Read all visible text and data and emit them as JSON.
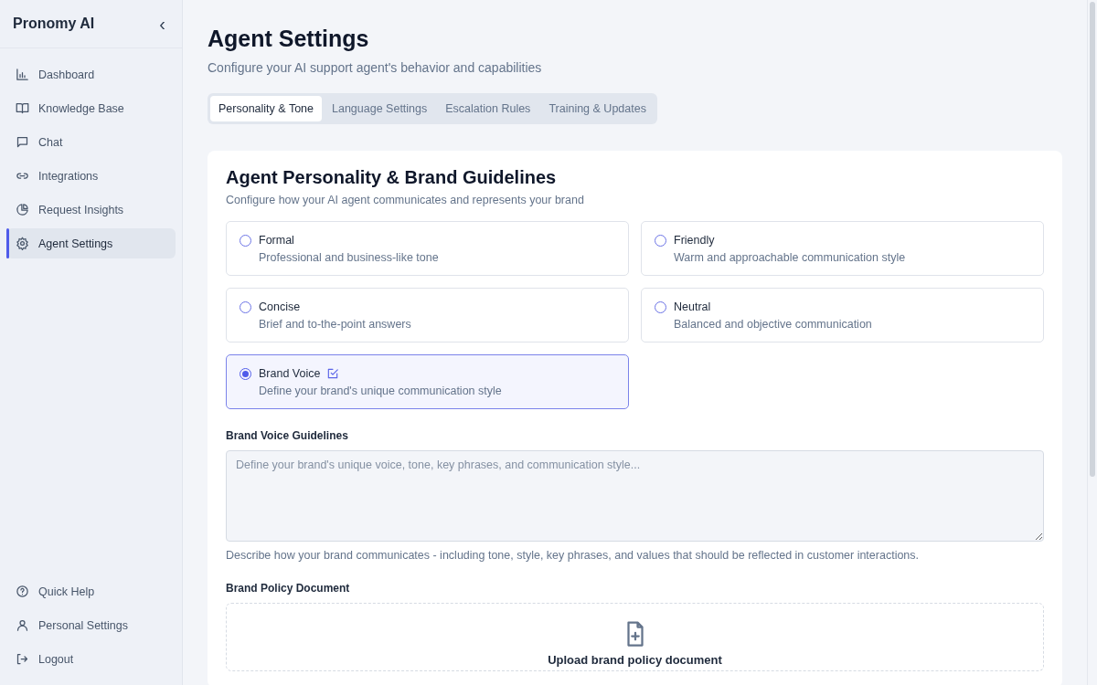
{
  "sidebar": {
    "brand": "Pronomy AI",
    "collapse_icon": "‹",
    "items": [
      {
        "label": "Dashboard",
        "selected": false
      },
      {
        "label": "Knowledge Base",
        "selected": false
      },
      {
        "label": "Chat",
        "selected": false
      },
      {
        "label": "Integrations",
        "selected": false
      },
      {
        "label": "Request Insights",
        "selected": false
      },
      {
        "label": "Agent Settings",
        "selected": true
      }
    ],
    "footer_items": [
      {
        "label": "Quick Help"
      },
      {
        "label": "Personal Settings"
      },
      {
        "label": "Logout"
      }
    ]
  },
  "header": {
    "title": "Agent Settings",
    "subtitle": "Configure your AI support agent's behavior and capabilities"
  },
  "tabs": [
    {
      "label": "Personality & Tone",
      "selected": true
    },
    {
      "label": "Language Settings",
      "selected": false
    },
    {
      "label": "Escalation Rules",
      "selected": false
    },
    {
      "label": "Training & Updates",
      "selected": false
    }
  ],
  "card": {
    "title": "Agent Personality & Brand Guidelines",
    "subtitle": "Configure how your AI agent communicates and represents your brand",
    "tones": [
      {
        "label": "Formal",
        "description": "Professional and business-like tone",
        "selected": false,
        "editable": false
      },
      {
        "label": "Friendly",
        "description": "Warm and approachable communication style",
        "selected": false,
        "editable": false
      },
      {
        "label": "Concise",
        "description": "Brief and to-the-point answers",
        "selected": false,
        "editable": false
      },
      {
        "label": "Neutral",
        "description": "Balanced and objective communication",
        "selected": false,
        "editable": false
      },
      {
        "label": "Brand Voice",
        "description": "Define your brand's unique communication style",
        "selected": true,
        "editable": true
      }
    ],
    "guidelines": {
      "label": "Brand Voice Guidelines",
      "placeholder": "Define your brand's unique voice, tone, key phrases, and communication style...",
      "help": "Describe how your brand communicates - including tone, style, key phrases, and values that should be reflected in customer interactions."
    },
    "policy": {
      "label": "Brand Policy Document",
      "upload_text": "Upload brand policy document"
    }
  }
}
